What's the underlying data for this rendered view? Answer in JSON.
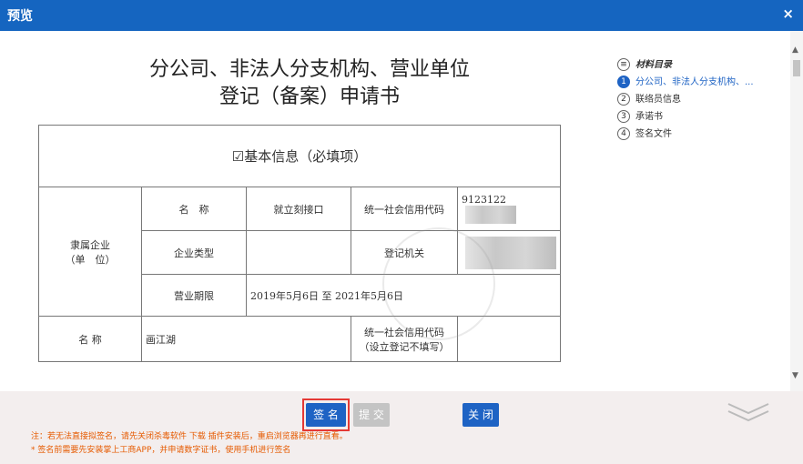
{
  "window": {
    "title": "预览",
    "close_glyph": "×"
  },
  "document": {
    "title_line1": "分公司、非法人分支机构、营业单位",
    "title_line2": "登记（备案）申请书",
    "section_header": "☑基本信息（必填项）",
    "rows": {
      "parent_label": "隶属企业\n（单　位）",
      "name_label": "名　称",
      "name_value": "就立刻接口",
      "credit_code_label": "统一社会信用代码",
      "credit_code_value": "9123122",
      "type_label": "企业类型",
      "type_value": "",
      "authority_label": "登记机关",
      "term_label": "营业期限",
      "term_value": "2019年5月6日 至 2021年5月6日",
      "branch_name_label": "名 称",
      "branch_name_value": "画江湖",
      "branch_code_label": "统一社会信用代码\n（设立登记不填写）",
      "branch_code_value": ""
    }
  },
  "toc": {
    "header": "材料目录",
    "items": [
      {
        "num": "1",
        "label": "分公司、非法人分支机构、...",
        "active": true
      },
      {
        "num": "2",
        "label": "联络员信息",
        "active": false
      },
      {
        "num": "3",
        "label": "承诺书",
        "active": false
      },
      {
        "num": "4",
        "label": "签名文件",
        "active": false
      }
    ]
  },
  "footer": {
    "sign_label": "签 名",
    "submit_label": "提 交",
    "close_label": "关 闭",
    "note1": "注：若无法直接拟签名，请先关闭杀毒软件 下载 插件安装后，重启浏览器再进行直看。",
    "note2": "* 签名前需要先安装掌上工商APP，并申请数字证书，使用手机进行签名"
  },
  "colors": {
    "accent": "#1e63c4",
    "titlebar": "#1565c0",
    "highlight": "#e53935",
    "note": "#e65a00"
  }
}
